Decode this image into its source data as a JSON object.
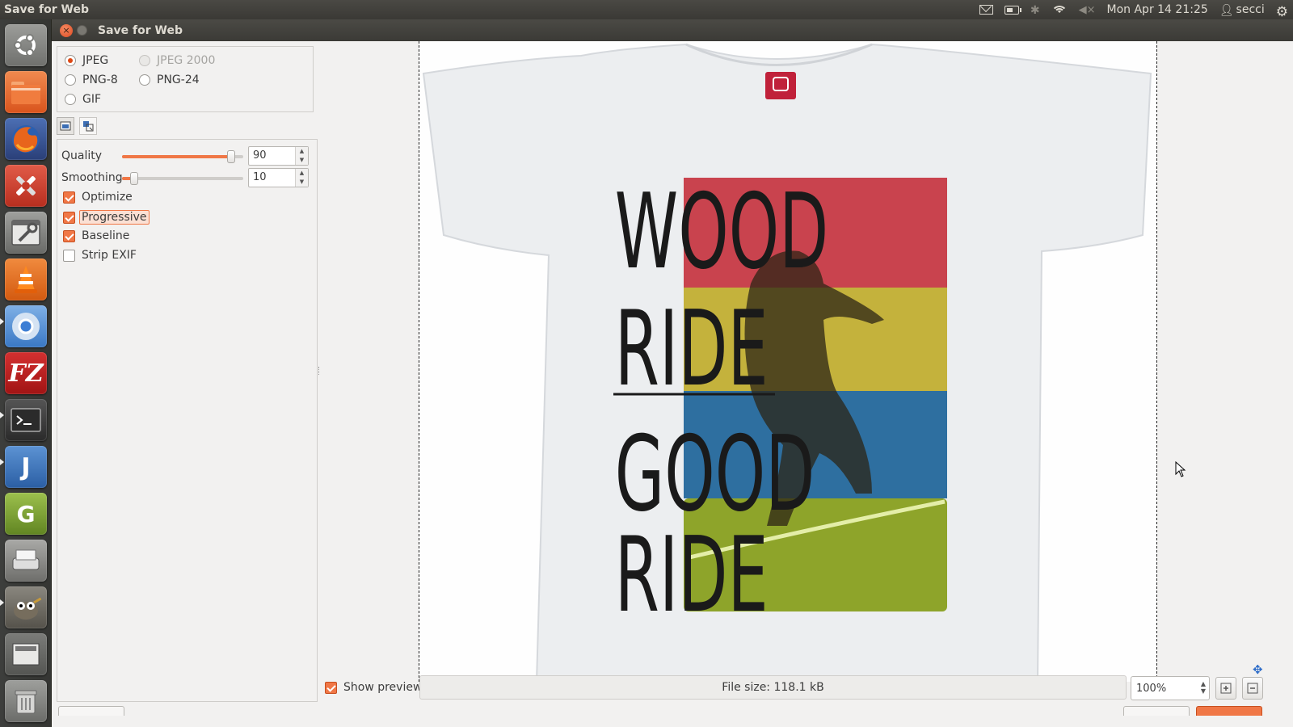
{
  "topbar": {
    "app_title": "Save for Web",
    "clock": "Mon Apr 14 21:25",
    "user": "secci",
    "icons": [
      "mail-icon",
      "battery-icon",
      "bluetooth-icon",
      "wifi-icon",
      "volume-muted-icon",
      "user-icon",
      "gear-icon"
    ]
  },
  "launcher": {
    "items": [
      {
        "name": "dash-home",
        "icon": "ubuntu-logo-icon",
        "color": "#8a8b88"
      },
      {
        "name": "files",
        "icon": "folder-icon",
        "color": "#e8662f"
      },
      {
        "name": "firefox",
        "icon": "firefox-icon",
        "color": "#d85b1f"
      },
      {
        "name": "system-settings",
        "icon": "settings-tools-icon",
        "color": "#cf3c2a"
      },
      {
        "name": "system-tool",
        "icon": "wrench-window-icon",
        "color": "#7d7e7b"
      },
      {
        "name": "vlc",
        "icon": "vlc-cone-icon",
        "color": "#e06a1c"
      },
      {
        "name": "chromium",
        "icon": "chromium-icon",
        "color": "#4f8fd4"
      },
      {
        "name": "filezilla",
        "icon": "filezilla-icon",
        "color": "#bf1e1e"
      },
      {
        "name": "terminal",
        "icon": "terminal-icon",
        "color": "#2c2c2c"
      },
      {
        "name": "jabref",
        "icon": "jabref-icon",
        "color": "#3d77b8"
      },
      {
        "name": "gimp-dev",
        "icon": "gimp-green-icon",
        "color": "#7ea53a"
      },
      {
        "name": "scanner",
        "icon": "scanner-icon",
        "color": "#8b8a86"
      },
      {
        "name": "gimp",
        "icon": "gimp-wilber-icon",
        "color": "#6d6a63"
      },
      {
        "name": "workspace-switcher",
        "icon": "workspaces-icon",
        "color": "#6e6f6c"
      },
      {
        "name": "trash",
        "icon": "trash-icon",
        "color": "#8c8d8a"
      }
    ]
  },
  "dialog": {
    "title": "Save for Web"
  },
  "formats": {
    "jpeg": "JPEG",
    "jpeg2000": "JPEG 2000",
    "png8": "PNG-8",
    "png24": "PNG-24",
    "gif": "GIF",
    "selected": "JPEG"
  },
  "tabs": [
    {
      "icon": "image-settings-icon",
      "active": true
    },
    {
      "icon": "resize-icon",
      "active": false
    }
  ],
  "options": {
    "quality_label": "Quality",
    "quality_value": "90",
    "quality_fraction": 0.9,
    "smoothing_label": "Smoothing",
    "smoothing_value": "10",
    "smoothing_fraction": 0.1,
    "optimize_label": "Optimize",
    "optimize_checked": true,
    "progressive_label": "Progressive",
    "progressive_checked": true,
    "baseline_label": "Baseline",
    "baseline_checked": true,
    "strip_exif_label": "Strip EXIF",
    "strip_exif_checked": false
  },
  "preview": {
    "tshirt_text_lines": [
      "WOOD",
      "RIDE",
      "GOOD",
      "RIDE"
    ],
    "stripe_colors": [
      "#c9434e",
      "#c4b23c",
      "#2e6fa0",
      "#8ea42a"
    ]
  },
  "bottom": {
    "show_preview_label": "Show preview",
    "show_preview_checked": true,
    "file_size": "File size: 118.1 kB",
    "zoom": "100%"
  },
  "colors": {
    "accent": "#f07746",
    "radio_accent": "#dd4814",
    "panel_bg": "#f2f1f0",
    "topbar_bg": "#3c3b37"
  }
}
